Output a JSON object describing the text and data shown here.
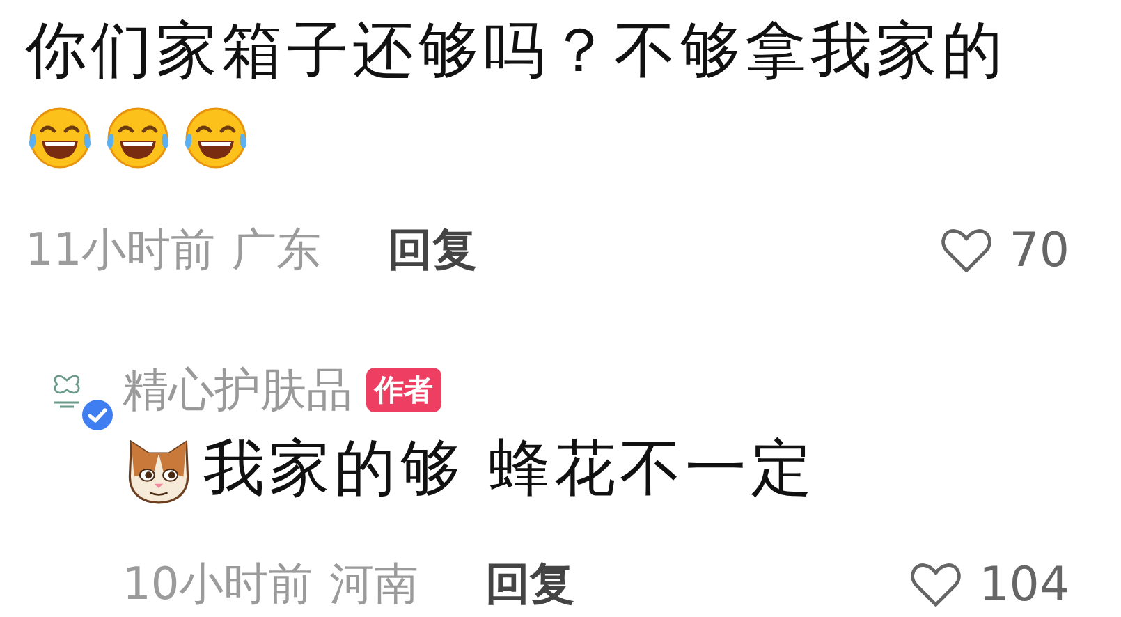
{
  "comments": [
    {
      "text": "你们家箱子还够吗？不够拿我家的",
      "emojis": [
        {
          "kind": "laugh-cry"
        },
        {
          "kind": "laugh-cry"
        },
        {
          "kind": "laugh-cry"
        }
      ],
      "time": "11小时前",
      "location": "广东",
      "reply": "回复",
      "likes": "70"
    },
    {
      "author": {
        "name": "精心护肤品",
        "badge": "作者",
        "verified": true
      },
      "lead_emoji": {
        "kind": "cat"
      },
      "text": "我家的够 蜂花不一定",
      "time": "10小时前",
      "location": "河南",
      "reply": "回复",
      "likes": "104"
    }
  ]
}
